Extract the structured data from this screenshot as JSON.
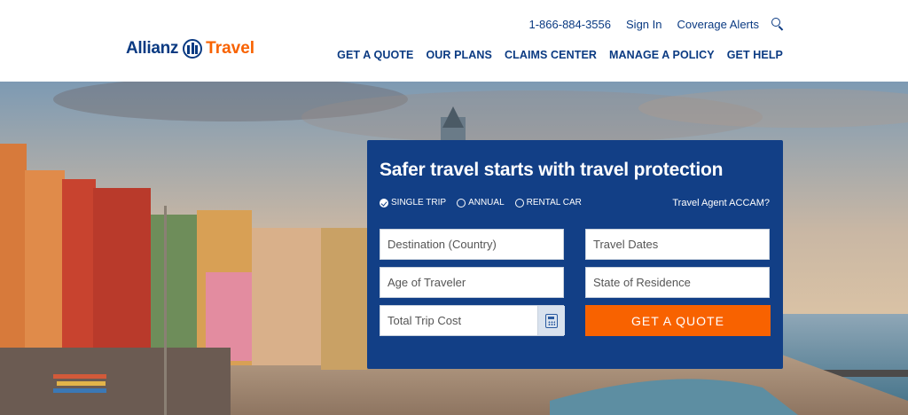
{
  "header": {
    "logo": {
      "brand": "Allianz",
      "product": "Travel"
    },
    "utility": {
      "phone": "1-866-884-3556",
      "sign_in": "Sign In",
      "coverage_alerts": "Coverage Alerts",
      "search_icon": "search-icon"
    },
    "nav": [
      "GET A QUOTE",
      "OUR PLANS",
      "CLAIMS CENTER",
      "MANAGE A POLICY",
      "GET HELP"
    ]
  },
  "quote_form": {
    "title": "Safer travel starts with travel protection",
    "trip_types": [
      {
        "label": "SINGLE TRIP",
        "selected": true
      },
      {
        "label": "ANNUAL",
        "selected": false
      },
      {
        "label": "RENTAL CAR",
        "selected": false
      }
    ],
    "agent_link": "Travel Agent ACCAM?",
    "fields": {
      "destination": "Destination (Country)",
      "dates": "Travel Dates",
      "age": "Age of Traveler",
      "residence": "State of Residence",
      "trip_cost": "Total Trip Cost"
    },
    "calculator_icon": "calculator-icon",
    "submit": "GET A QUOTE"
  },
  "colors": {
    "brand_blue": "#0a3a82",
    "panel_blue": "#123f86",
    "accent_orange": "#f86200"
  }
}
